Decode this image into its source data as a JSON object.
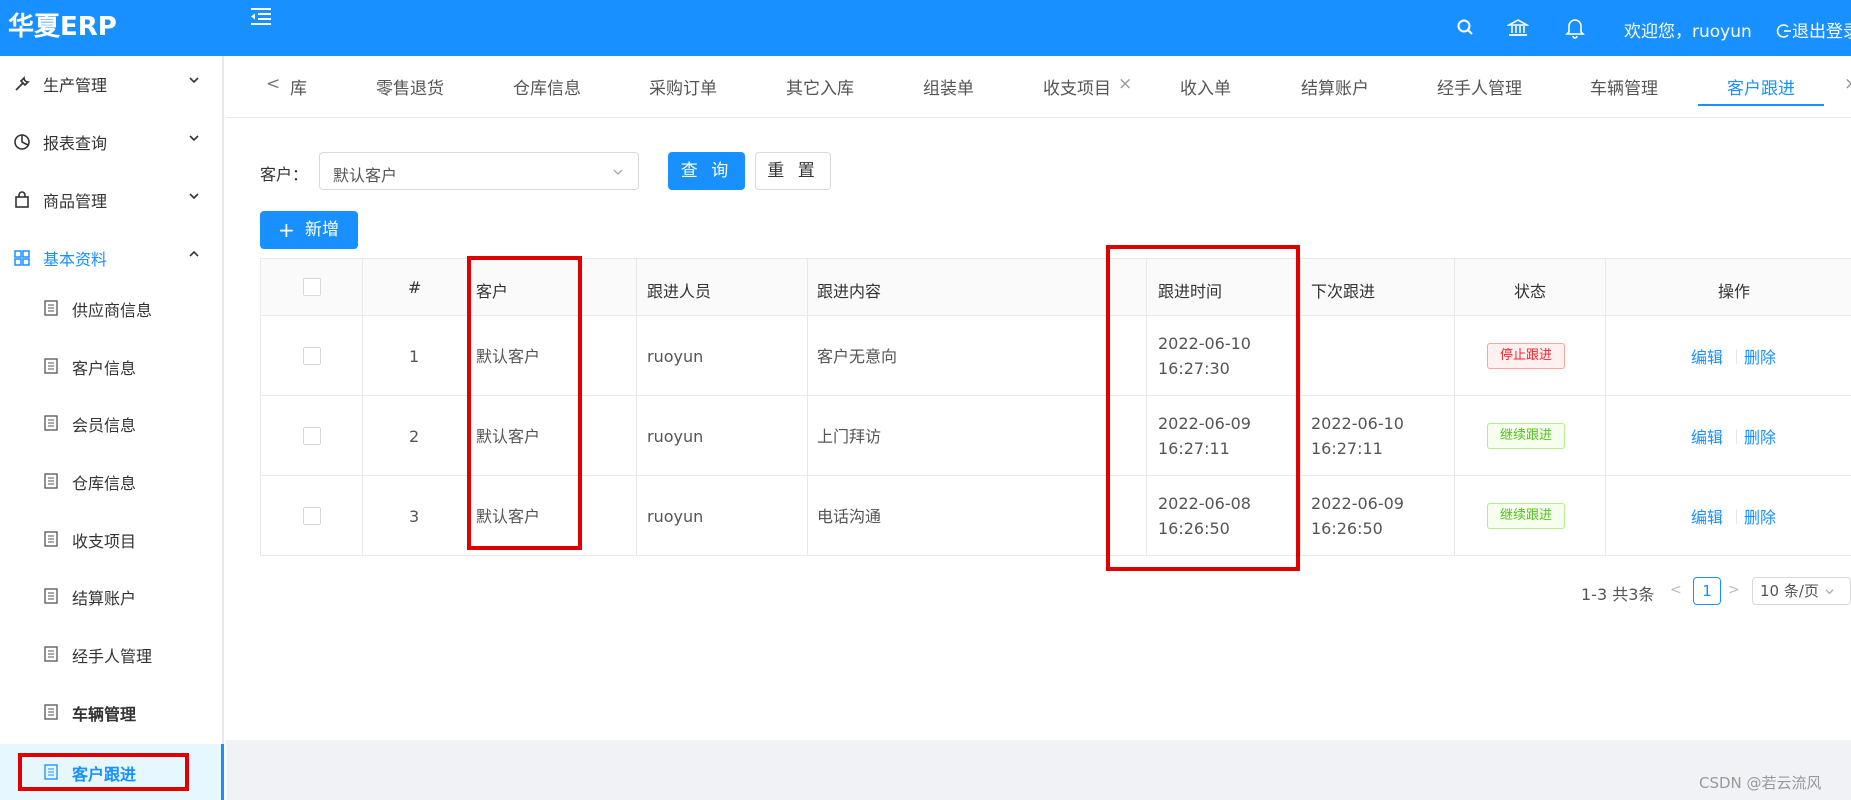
{
  "header": {
    "logo": "华夏ERP",
    "welcome": "欢迎您，ruoyun",
    "logout": "退出登录"
  },
  "sidebar": {
    "menus": [
      {
        "label": "生产管理",
        "icon": "wrench-icon"
      },
      {
        "label": "报表查询",
        "icon": "pie-chart-icon"
      },
      {
        "label": "商品管理",
        "icon": "shopping-bag-icon"
      },
      {
        "label": "基本资料",
        "icon": "appstore-icon"
      }
    ],
    "subs": [
      "供应商信息",
      "客户信息",
      "会员信息",
      "仓库信息",
      "收支项目",
      "结算账户",
      "经手人管理",
      "车辆管理",
      "客户跟进"
    ]
  },
  "tabs": [
    "库",
    "零售退货",
    "仓库信息",
    "采购订单",
    "其它入库",
    "组装单",
    "收支项目",
    "收入单",
    "结算账户",
    "经手人管理",
    "车辆管理",
    "客户跟进"
  ],
  "search": {
    "label": "客户：",
    "value": "默认客户",
    "query_btn": "查 询",
    "reset_btn": "重 置"
  },
  "add_btn": "新增",
  "table": {
    "headers": [
      "#",
      "客户",
      "跟进人员",
      "跟进内容",
      "跟进时间",
      "下次跟进",
      "状态",
      "操作"
    ],
    "rows": [
      {
        "no": "1",
        "customer": "默认客户",
        "person": "ruoyun",
        "content": "客户无意向",
        "time_date": "2022-06-10",
        "time_clock": "16:27:30",
        "next_date": "",
        "next_clock": "",
        "status": "停止跟进",
        "edit": "编辑",
        "delete": "删除"
      },
      {
        "no": "2",
        "customer": "默认客户",
        "person": "ruoyun",
        "content": "上门拜访",
        "time_date": "2022-06-09",
        "time_clock": "16:27:11",
        "next_date": "2022-06-10",
        "next_clock": "16:27:11",
        "status": "继续跟进",
        "edit": "编辑",
        "delete": "删除"
      },
      {
        "no": "3",
        "customer": "默认客户",
        "person": "ruoyun",
        "content": "电话沟通",
        "time_date": "2022-06-08",
        "time_clock": "16:26:50",
        "next_date": "2022-06-09",
        "next_clock": "16:26:50",
        "status": "继续跟进",
        "edit": "编辑",
        "delete": "删除"
      }
    ]
  },
  "pagination": {
    "total": "1-3 共3条",
    "current": "1",
    "page_size": "10 条/页"
  },
  "watermark": "CSDN @若云流风",
  "colors": {
    "primary": "#1890ff",
    "header": "#1890ff",
    "highlight": "#e00000",
    "stop": "#f5222d",
    "continue": "#52c41a"
  }
}
